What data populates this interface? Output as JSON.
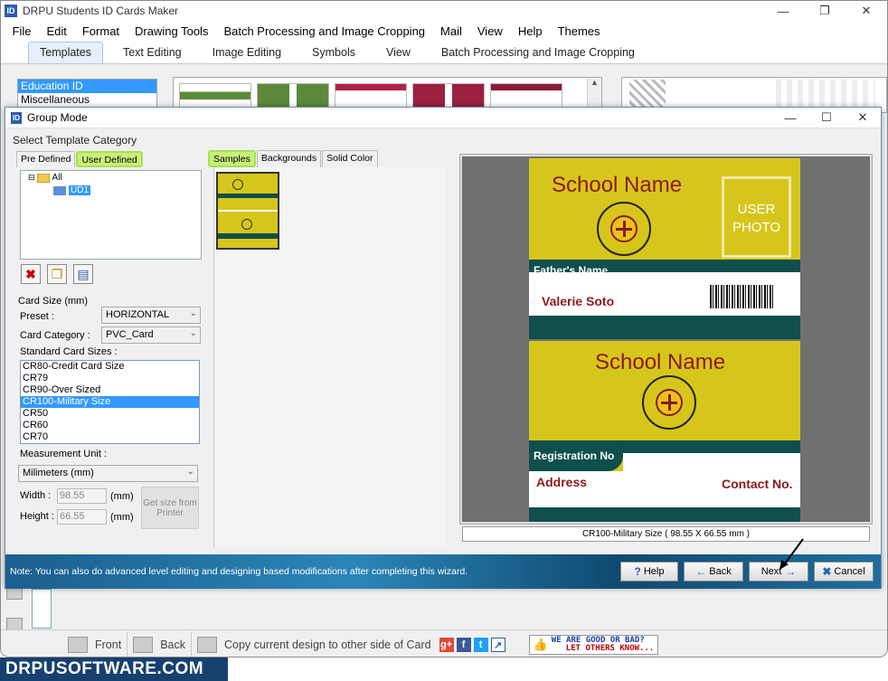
{
  "app": {
    "title": "DRPU Students ID Cards Maker",
    "menu": [
      "File",
      "Edit",
      "Format",
      "Drawing Tools",
      "Batch Processing and Image Cropping",
      "Mail",
      "View",
      "Help",
      "Themes"
    ],
    "ribbon_tabs": [
      "Templates",
      "Text Editing",
      "Image Editing",
      "Symbols",
      "View",
      "Batch Processing and Image Cropping"
    ],
    "categories": [
      "Education ID",
      "Miscellaneous"
    ]
  },
  "dialog": {
    "title": "Group Mode",
    "select_template_label": "Select Template Category",
    "left_tabs": {
      "predefined": "Pre Defined",
      "user_defined": "User Defined"
    },
    "tree": {
      "root": "All",
      "child": "UD1"
    },
    "card_size_label": "Card Size (mm)",
    "preset_label": "Preset :",
    "preset_value": "HORIZONTAL",
    "category_label": "Card Category :",
    "category_value": "PVC_Card",
    "standard_sizes_label": "Standard Card Sizes :",
    "standard_sizes": [
      "CR80-Credit Card Size",
      "CR79",
      "CR90-Over Sized",
      "CR100-Military Size",
      "CR50",
      "CR60",
      "CR70"
    ],
    "selected_size_index": 3,
    "unit_label": "Measurement Unit :",
    "unit_value": "Milimeters (mm)",
    "width_label": "Width :",
    "width_value": "98.55",
    "height_label": "Height :",
    "height_value": "66.55",
    "unit_suffix": "(mm)",
    "printer_btn": "Get size from Printer",
    "middle_tabs": {
      "samples": "Samples",
      "backgrounds": "Backgrounds",
      "solid": "Solid Color"
    },
    "preview": {
      "front": {
        "school": "School Name",
        "photo": "USER PHOTO",
        "father_label": "Father's Name",
        "name": "Valerie Soto"
      },
      "back": {
        "school": "School Name",
        "reg_label": "Registration No",
        "address": "Address",
        "contact": "Contact No."
      },
      "caption": "CR100-Military Size ( 98.55 X 66.55 mm )"
    },
    "footer_note": "Note: You can also do advanced level editing and designing based modifications after completing this wizard.",
    "buttons": {
      "help": "Help",
      "back": "Back",
      "next": "Next",
      "cancel": "Cancel"
    }
  },
  "bottom": {
    "front": "Front",
    "back": "Back",
    "copy": "Copy current design to other side of Card",
    "feedback_line1": "WE ARE GOOD OR BAD?",
    "feedback_line2": "LET OTHERS KNOW..."
  },
  "brand": "DRPUSOFTWARE.COM",
  "colors": {
    "card_yellow": "#d6c61b",
    "card_dark": "#0f4f4c",
    "card_red": "#8b1a1a",
    "selection_blue": "#3399ff",
    "highlight_green": "#c8f07c"
  },
  "icons": [
    "app-logo-icon",
    "minimize-icon",
    "restore-icon",
    "close-icon",
    "folder-icon",
    "delete-icon",
    "copy-icon",
    "image-icon",
    "help-icon",
    "back-arrow-icon",
    "next-arrow-icon",
    "cancel-icon",
    "google-plus-icon",
    "facebook-icon",
    "twitter-icon",
    "share-icon"
  ]
}
